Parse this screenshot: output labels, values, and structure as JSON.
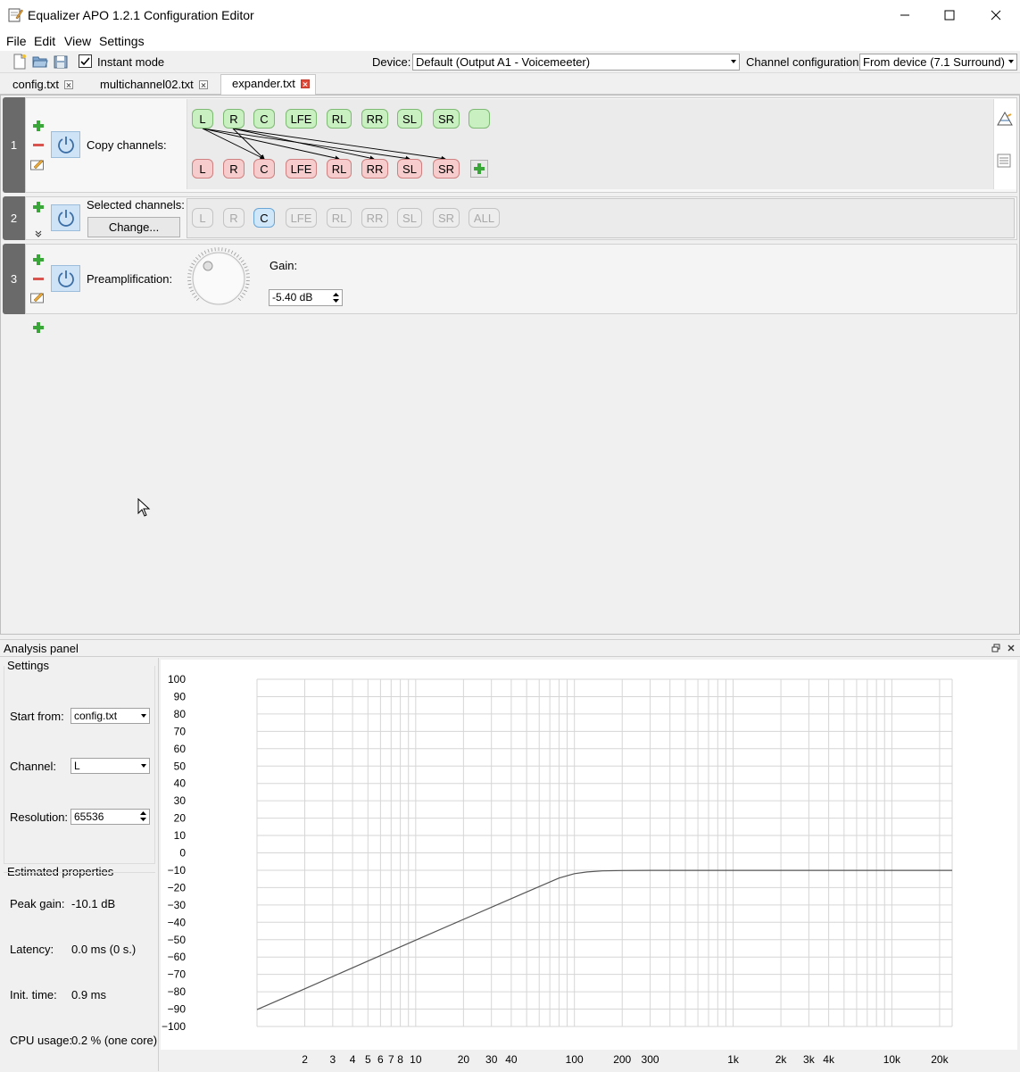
{
  "window": {
    "title": "Equalizer APO 1.2.1 Configuration Editor",
    "minimize": "—",
    "maximize": "☐",
    "close": "✕"
  },
  "menu": [
    "File",
    "Edit",
    "View",
    "Settings"
  ],
  "toolbar": {
    "instant_mode_label": "Instant mode",
    "instant_mode_checked": true,
    "device_label": "Device:",
    "device_value": "Default (Output A1 - Voicemeeter)",
    "channel_config_label": "Channel configuration:",
    "channel_config_value": "From device (7.1 Surround)"
  },
  "tabs": [
    {
      "label": "config.txt",
      "active": false
    },
    {
      "label": "multichannel02.txt",
      "active": false
    },
    {
      "label": "expander.txt",
      "active": true
    }
  ],
  "filters": [
    {
      "number": "1",
      "label": "Copy channels:",
      "source_channels": [
        "L",
        "R",
        "C",
        "LFE",
        "RL",
        "RR",
        "SL",
        "SR",
        ""
      ],
      "target_channels": [
        "L",
        "R",
        "C",
        "LFE",
        "RL",
        "RR",
        "SL",
        "SR"
      ]
    },
    {
      "number": "2",
      "label": "Selected channels:",
      "change_label": "Change...",
      "channels": [
        "L",
        "R",
        "C",
        "LFE",
        "RL",
        "RR",
        "SL",
        "SR",
        "ALL"
      ],
      "selected": "C"
    },
    {
      "number": "3",
      "label": "Preamplification:",
      "gain_label": "Gain:",
      "gain_value": "-5.40 dB"
    }
  ],
  "analysis": {
    "title": "Analysis panel",
    "settings_title": "Settings",
    "start_from_label": "Start from:",
    "start_from_value": "config.txt",
    "channel_label": "Channel:",
    "channel_value": "L",
    "resolution_label": "Resolution:",
    "resolution_value": "65536",
    "estimated_title": "Estimated properties",
    "peak_gain_label": "Peak gain:",
    "peak_gain_value": "-10.1 dB",
    "latency_label": "Latency:",
    "latency_value": "0.0 ms (0 s.)",
    "init_time_label": "Init. time:",
    "init_time_value": "0.9 ms",
    "cpu_label": "CPU usage:",
    "cpu_value": "0.2 % (one core)"
  },
  "chart_data": {
    "type": "line",
    "x_scale": "log",
    "xlim": [
      1,
      24000
    ],
    "ylim": [
      -100,
      100
    ],
    "y_ticks": [
      100,
      90,
      80,
      70,
      60,
      50,
      40,
      30,
      20,
      10,
      0,
      -10,
      -20,
      -30,
      -40,
      -50,
      -60,
      -70,
      -80,
      -90,
      -100
    ],
    "x_tick_labels": [
      {
        "x": 2,
        "label": "2"
      },
      {
        "x": 3,
        "label": "3"
      },
      {
        "x": 4,
        "label": "4"
      },
      {
        "x": 5,
        "label": "5"
      },
      {
        "x": 6,
        "label": "6"
      },
      {
        "x": 7,
        "label": "7"
      },
      {
        "x": 8,
        "label": "8"
      },
      {
        "x": 10,
        "label": "10"
      },
      {
        "x": 20,
        "label": "20"
      },
      {
        "x": 30,
        "label": "30"
      },
      {
        "x": 40,
        "label": "40"
      },
      {
        "x": 100,
        "label": "100"
      },
      {
        "x": 200,
        "label": "200"
      },
      {
        "x": 300,
        "label": "300"
      },
      {
        "x": 1000,
        "label": "1k"
      },
      {
        "x": 2000,
        "label": "2k"
      },
      {
        "x": 3000,
        "label": "3k"
      },
      {
        "x": 4000,
        "label": "4k"
      },
      {
        "x": 10000,
        "label": "10k"
      },
      {
        "x": 20000,
        "label": "20k"
      }
    ],
    "grid": true,
    "series": [
      {
        "color": "#555555",
        "x": [
          1,
          2,
          5,
          10,
          20,
          50,
          80,
          100,
          120,
          150,
          200,
          300,
          1000,
          10000,
          24000
        ],
        "y": [
          -90.3,
          -78.3,
          -62.3,
          -50.3,
          -38.3,
          -22.5,
          -14.5,
          -12.0,
          -11.0,
          -10.4,
          -10.2,
          -10.1,
          -10.1,
          -10.1,
          -10.1
        ]
      }
    ]
  }
}
